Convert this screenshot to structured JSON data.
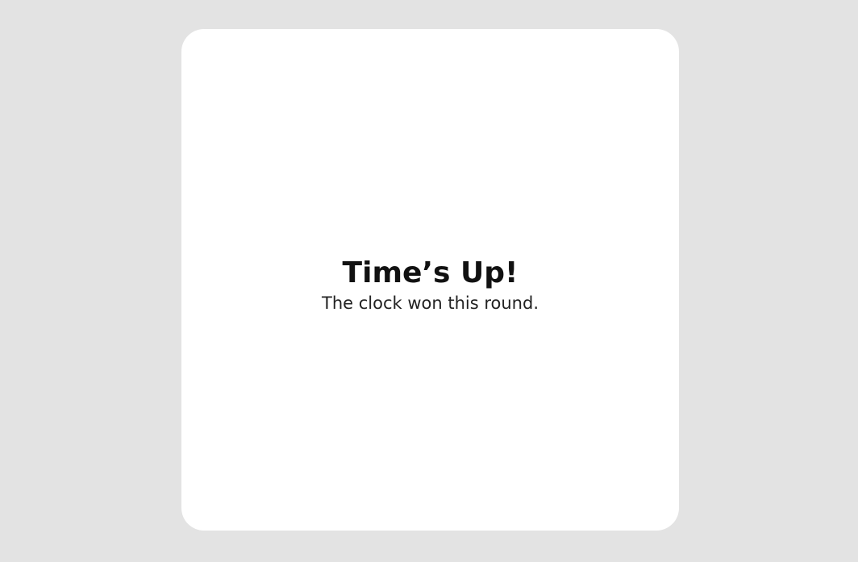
{
  "screen": {
    "title": "Time’s Up!",
    "subtitle": "The clock won this round."
  },
  "colors": {
    "background": "#e3e3e3",
    "panel": "#ffffff",
    "text": "#111111"
  }
}
